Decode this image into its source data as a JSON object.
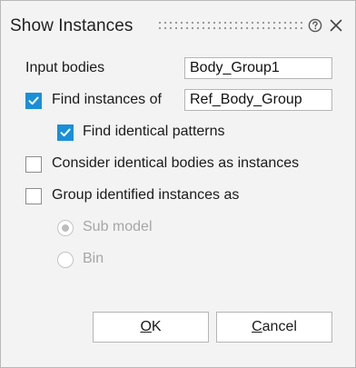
{
  "dialog": {
    "title": "Show Instances",
    "help_icon": "question-circle-icon",
    "close_icon": "close-x-icon"
  },
  "input_bodies": {
    "label": "Input bodies",
    "value": "Body_Group1"
  },
  "find_instances": {
    "label": "Find instances of",
    "checked": true,
    "value": "Ref_Body_Group"
  },
  "find_identical_patterns": {
    "label": "Find identical patterns",
    "checked": true
  },
  "consider_identical": {
    "label": "Consider identical bodies as instances",
    "checked": false
  },
  "group_identified": {
    "label": "Group identified instances as",
    "checked": false,
    "options": [
      {
        "label": "Sub model",
        "selected": true,
        "enabled": false
      },
      {
        "label": "Bin",
        "selected": false,
        "enabled": false
      }
    ]
  },
  "buttons": {
    "ok_mnemonic": "O",
    "ok_rest": "K",
    "cancel_mnemonic": "C",
    "cancel_rest": "ancel"
  },
  "colors": {
    "accent": "#1a8fd8",
    "background": "#f3f3f3",
    "disabled_text": "#a6a6a6"
  }
}
